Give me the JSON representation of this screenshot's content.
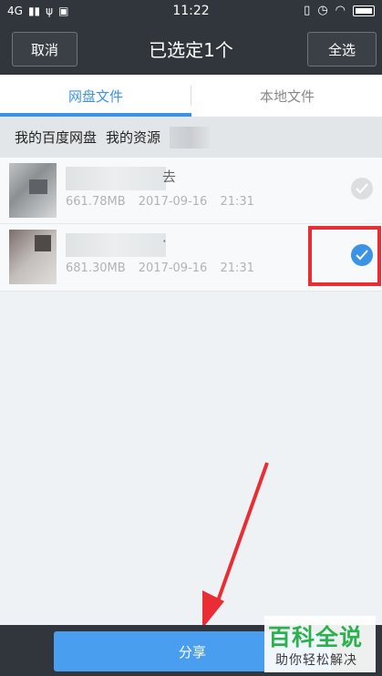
{
  "statusbar": {
    "network": "4G",
    "time": "11:22"
  },
  "topbar": {
    "cancel_label": "取消",
    "title": "已选定1个",
    "select_all_label": "全选"
  },
  "tabs": [
    {
      "label": "网盘文件",
      "active": true
    },
    {
      "label": "本地文件",
      "active": false
    }
  ],
  "breadcrumb": [
    "我的百度网盘",
    "我的资源"
  ],
  "files": [
    {
      "name_suffix": "去",
      "size": "661.78MB",
      "date": "2017-09-16",
      "time": "21:31",
      "checked": false
    },
    {
      "name_suffix": "·",
      "size": "681.30MB",
      "date": "2017-09-16",
      "time": "21:31",
      "checked": true
    }
  ],
  "bottom": {
    "share_label": "分享"
  },
  "watermark": {
    "brand": "百科全说",
    "tagline": "助你轻松解决"
  },
  "colors": {
    "accent": "#3b93e6",
    "dark_bar": "#30363c",
    "highlight": "#ea2d35",
    "watermark_green": "#2db14f"
  }
}
